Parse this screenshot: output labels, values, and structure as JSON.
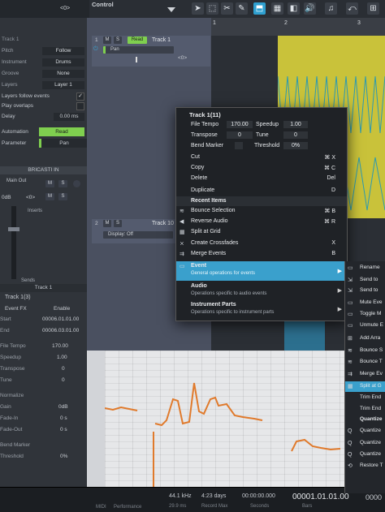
{
  "topbar": {
    "control_label": "Control",
    "left_value": "<0>"
  },
  "inspector": {
    "track_name": "Track 1",
    "rows": [
      {
        "label": "Pitch",
        "value": "Follow"
      },
      {
        "label": "Instrument",
        "value": "Drums"
      },
      {
        "label": "Groove",
        "value": "None"
      },
      {
        "label": "Layers",
        "value": "Layer 1"
      }
    ],
    "layers_follow_events": "Layers follow events",
    "play_overlaps": "Play overlaps",
    "delay_label": "Delay",
    "delay_value": "0.00 ms",
    "automation_label": "Automation",
    "automation_value": "Read",
    "parameter_label": "Parameter",
    "parameter_value": "Pan",
    "channel_name": "BRICASTI IN",
    "main_out": "Main Out",
    "m": "M",
    "s": "S",
    "level": "0dB",
    "pan": "<0>",
    "inserts": "Inserts",
    "sends": "Sends",
    "track1_footer": "Track 1",
    "event_title": "Track 1(3)",
    "event_fx": "Event FX",
    "enable": "Enable",
    "start_label": "Start",
    "start_value": "00006.01.01.00",
    "end_label": "End",
    "end_value": "00006.03.01.00",
    "file_tempo_label": "File Tempo",
    "file_tempo_value": "170.00",
    "speedup_label": "Speedup",
    "speedup_value": "1.00",
    "transpose_label": "Transpose",
    "transpose_value": "0",
    "tune_label": "Tune",
    "tune_value": "0",
    "normalize_label": "Normalize",
    "gain_label": "Gain",
    "gain_value": "0dB",
    "fadein_label": "Fade-In",
    "fadein_value": "0 s",
    "fadeout_label": "Fade-Out",
    "fadeout_value": "0 s",
    "bend_marker_label": "Bend Marker",
    "threshold_label": "Threshold",
    "threshold_value": "0%"
  },
  "tracks": {
    "t1_num": "1",
    "t1_name": "Track 1",
    "t1_read": "Read",
    "t1_param": "Pan",
    "t1_pan": "<0>",
    "t2_num": "2",
    "t2_name": "Track 10",
    "t2_display": "Display: Off",
    "m": "M",
    "s": "S"
  },
  "ruler": {
    "bar1": "1",
    "bar2": "2",
    "bar3": "3"
  },
  "context_menu": {
    "header": "Track 1(11)",
    "file_tempo_label": "File Tempo",
    "file_tempo_value": "170.00",
    "speedup_label": "Speedup",
    "speedup_value": "1.00",
    "transpose_label": "Transpose",
    "transpose_value": "0",
    "tune_label": "Tune",
    "tune_value": "0",
    "bend_marker_label": "Bend Marker",
    "threshold_label": "Threshold",
    "threshold_value": "0%",
    "cut": "Cut",
    "cut_sc": "⌘ X",
    "copy": "Copy",
    "copy_sc": "⌘ C",
    "delete": "Delete",
    "delete_sc": "Del",
    "duplicate": "Duplicate",
    "duplicate_sc": "D",
    "recent_items": "Recent Items",
    "bounce_selection": "Bounce Selection",
    "bounce_sc": "⌘ B",
    "reverse_audio": "Reverse Audio",
    "reverse_sc": "⌘ R",
    "split_at_grid": "Split at Grid",
    "create_crossfades": "Create Crossfades",
    "crossfades_sc": "X",
    "merge_events": "Merge Events",
    "merge_sc": "B",
    "event": "Event",
    "event_sub": "General operations for events",
    "audio": "Audio",
    "audio_sub": "Operations specific to audio events",
    "instrument_parts": "Instrument Parts",
    "instrument_sub": "Operations specific to instrument parts"
  },
  "submenu": {
    "items": [
      "Rename",
      "Send to",
      "Send to",
      "Mute Eve",
      "Toggle M",
      "Unmute E",
      "Add Arra",
      "Bounce S",
      "Bounce T",
      "Merge Ev",
      "Split at G",
      "Trim End",
      "Trim End",
      "Quantize",
      "Quantize",
      "Quantize",
      "Quantize",
      "Restore T"
    ]
  },
  "status": {
    "midi": "MIDI",
    "performance": "Performance",
    "sample_rate": "44.1 kHz",
    "sample_rate_sub": "29.9 ms",
    "record_max": "4:23 days",
    "record_max_label": "Record Max",
    "seconds": "00:00:00.000",
    "seconds_label": "Seconds",
    "bars": "00001.01.01.00",
    "bars_label": "Bars",
    "right_value": "0000"
  },
  "colors": {
    "accent": "#3aa0cc",
    "clip_yellow": "#c9c23a",
    "green_read": "#7fcf4f",
    "pitch_orange": "#e07a2c"
  }
}
